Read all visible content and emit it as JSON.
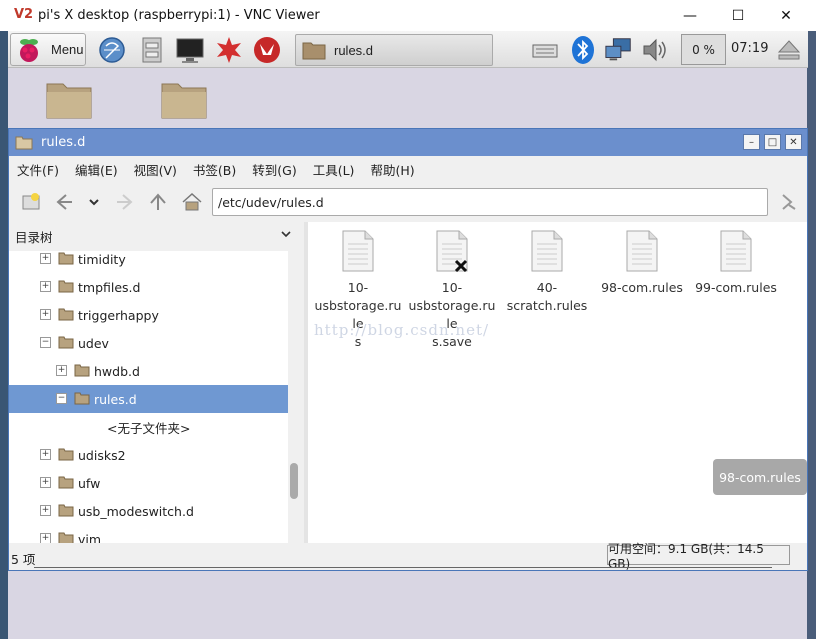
{
  "vnc": {
    "logo": "V2",
    "title": "pi's X desktop (raspberrypi:1) - VNC Viewer",
    "minimize": "—",
    "maximize": "☐",
    "close": "✕"
  },
  "taskbar": {
    "menu_label": "Menu",
    "task_label": "rules.d",
    "cpu": "0 %",
    "clock": "07:19"
  },
  "file_manager": {
    "title": "rules.d",
    "menu": [
      "文件(F)",
      "编辑(E)",
      "视图(V)",
      "书签(B)",
      "转到(G)",
      "工具(L)",
      "帮助(H)"
    ],
    "path": "/etc/udev/rules.d",
    "sidebar_header": "目录树",
    "tree": [
      {
        "label": "timidity",
        "level": 0,
        "expander": "+"
      },
      {
        "label": "tmpfiles.d",
        "level": 0,
        "expander": "+"
      },
      {
        "label": "triggerhappy",
        "level": 0,
        "expander": "+"
      },
      {
        "label": "udev",
        "level": 0,
        "expander": "−"
      },
      {
        "label": "hwdb.d",
        "level": 1,
        "expander": "+"
      },
      {
        "label": "rules.d",
        "level": 1,
        "expander": "−",
        "selected": true
      },
      {
        "label": "<无子文件夹>",
        "level": 2,
        "expander": ""
      },
      {
        "label": "udisks2",
        "level": 0,
        "expander": "+"
      },
      {
        "label": "ufw",
        "level": 0,
        "expander": "+"
      },
      {
        "label": "usb_modeswitch.d",
        "level": 0,
        "expander": "+"
      },
      {
        "label": "vim",
        "level": 0,
        "expander": "+"
      }
    ],
    "files": [
      {
        "name": "10-\nusbstorage.rule\ns",
        "broken": false
      },
      {
        "name": "10-\nusbstorage.rule\ns.save",
        "broken": true
      },
      {
        "name": "40-\nscratch.rules",
        "broken": false
      },
      {
        "name": "98-com.rules",
        "broken": false
      },
      {
        "name": "99-com.rules",
        "broken": false
      }
    ],
    "watermark": "http://blog.csdn.net/",
    "status_left": "5 项",
    "status_right": "可用空间：9.1 GB(共：14.5 GB)"
  },
  "tooltip": "98-com.rules",
  "colors": {
    "title_bar": "#6b8fcd",
    "selection": "#6f98d2",
    "desktop": "#d9d6e3"
  }
}
